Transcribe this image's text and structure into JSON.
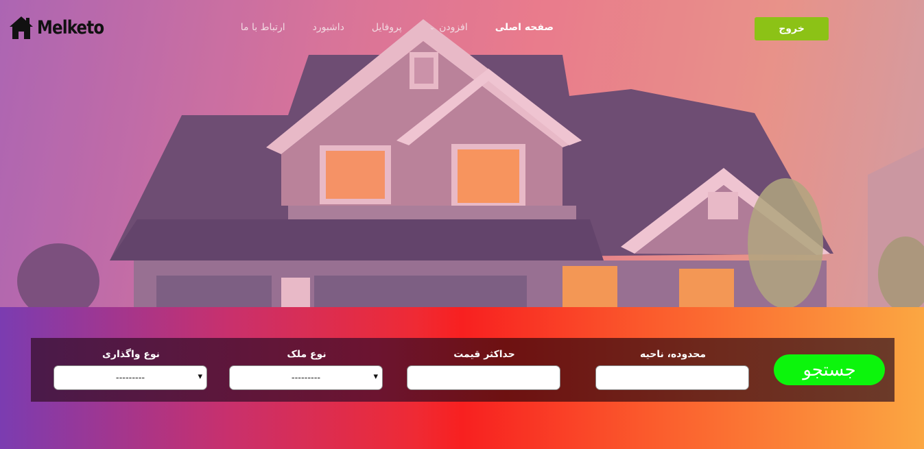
{
  "brand": {
    "name": "Melketo"
  },
  "nav": {
    "items": [
      {
        "label": "صفحه اصلی",
        "active": true
      },
      {
        "label": "افزودن",
        "dropdown": true
      },
      {
        "label": "پروفایل"
      },
      {
        "label": "داشبورد"
      },
      {
        "label": "ارتباط با ما"
      }
    ],
    "logout_label": "خروج"
  },
  "search": {
    "button_label": "جستجو",
    "fields": {
      "region": {
        "label": "محدوده، ناحیه",
        "value": ""
      },
      "max_price": {
        "label": "حداکثر قیمت",
        "value": ""
      },
      "property_type": {
        "label": "نوع ملک",
        "selected": "---------"
      },
      "transfer_type": {
        "label": "نوع واگذاری",
        "selected": "---------"
      }
    }
  },
  "colors": {
    "logout": "#8cc216",
    "search_button": "#0cf50c"
  },
  "icons": {
    "logo": "house-icon",
    "dropdown": "chevron-down-icon",
    "select": "chevron-down-icon"
  }
}
